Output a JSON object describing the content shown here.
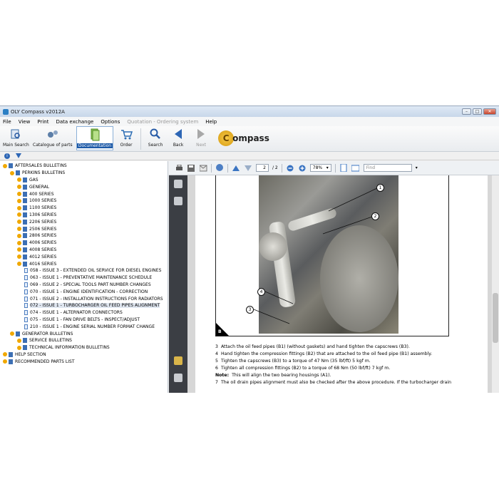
{
  "window": {
    "title": "OLY Compass v2012A"
  },
  "menu": [
    "File",
    "View",
    "Print",
    "Data exchange",
    "Options",
    "Quotation - Ordering system",
    "Help"
  ],
  "menu_disabled": [
    false,
    false,
    false,
    false,
    false,
    true,
    false
  ],
  "toolbar": {
    "main_search": "Main Search",
    "catalogue": "Catalogue of parts",
    "documentation": "Documentation",
    "order": "Order",
    "search": "Search",
    "back": "Back",
    "next": "Next",
    "logo_text": "ompass"
  },
  "tree": [
    {
      "level": 0,
      "type": "book",
      "label": "AFTERSALES BULLETINS"
    },
    {
      "level": 1,
      "type": "book",
      "label": "PERKINS BULLETINS"
    },
    {
      "level": 2,
      "type": "book",
      "label": "GAS"
    },
    {
      "level": 2,
      "type": "book",
      "label": "GENERAL"
    },
    {
      "level": 2,
      "type": "book",
      "label": "400 SERIES"
    },
    {
      "level": 2,
      "type": "book",
      "label": "1000 SERIES"
    },
    {
      "level": 2,
      "type": "book",
      "label": "1100 SERIES"
    },
    {
      "level": 2,
      "type": "book",
      "label": "1306 SERIES"
    },
    {
      "level": 2,
      "type": "book",
      "label": "2206 SERIES"
    },
    {
      "level": 2,
      "type": "book",
      "label": "2506 SERIES"
    },
    {
      "level": 2,
      "type": "book",
      "label": "2806 SERIES"
    },
    {
      "level": 2,
      "type": "book",
      "label": "4006 SERIES"
    },
    {
      "level": 2,
      "type": "book",
      "label": "4008 SERIES"
    },
    {
      "level": 2,
      "type": "book",
      "label": "4012 SERIES"
    },
    {
      "level": 2,
      "type": "book",
      "label": "4016 SERIES"
    },
    {
      "level": 3,
      "type": "doc",
      "label": "058 - ISSUE 3 - EXTENDED OIL SERVICE FOR DIESEL ENGINES"
    },
    {
      "level": 3,
      "type": "doc",
      "label": "063 - ISSUE 1 - PREVENTATIVE MAINTENANCE SCHEDULE"
    },
    {
      "level": 3,
      "type": "doc",
      "label": "069 - ISSUE 2 - SPECIAL TOOLS PART NUMBER CHANGES"
    },
    {
      "level": 3,
      "type": "doc",
      "label": "070 - ISSUE 1 - ENGINE IDENTIFICATION - CORRECTION"
    },
    {
      "level": 3,
      "type": "doc",
      "label": "071 - ISSUE 2 - INSTALLATION INSTRUCTIONS FOR RADIATORS"
    },
    {
      "level": 3,
      "type": "doc",
      "label": "072 - ISSUE 1 - TURBOCHARGER OIL FEED PIPES ALIGNMENT",
      "selected": true
    },
    {
      "level": 3,
      "type": "doc",
      "label": "074 - ISSUE 1 - ALTERNATOR CONNECTORS"
    },
    {
      "level": 3,
      "type": "doc",
      "label": "075 - ISSUE 1 - FAN DRIVE BELTS - INSPECT/ADJUST"
    },
    {
      "level": 3,
      "type": "doc",
      "label": "210 - ISSUE 1 - ENGINE SERIAL NUMBER FORMAT CHANGE"
    },
    {
      "level": 1,
      "type": "book",
      "label": "GENERATOR BULLETINS"
    },
    {
      "level": 2,
      "type": "book",
      "label": "SERVICE BULLETINS"
    },
    {
      "level": 2,
      "type": "book",
      "label": "TECHNICAL INFORMATION BULLETINS"
    },
    {
      "level": 0,
      "type": "book",
      "label": "HELP SECTION"
    },
    {
      "level": 0,
      "type": "book",
      "label": "RECOMMENDED PARTS LIST"
    }
  ],
  "pdf_toolbar": {
    "page_current": "2",
    "page_total": "/ 2",
    "zoom": "78%",
    "find_placeholder": "Find"
  },
  "figure": {
    "letter": "B",
    "callouts": [
      "1",
      "2",
      "4",
      "3"
    ]
  },
  "steps": [
    {
      "num": "3",
      "text": "Attach the oil feed pipes (B1) (without gaskets) and hand tighten the capscrews (B3)."
    },
    {
      "num": "4",
      "text": "Hand tighten the compression fittings (B2) that are attached to the oil feed pipe (B1) assembly."
    },
    {
      "num": "5",
      "text": "Tighten the capscrews (B3) to a torque of 47 Nm (35 lbf/ft) 5 kgf m."
    },
    {
      "num": "6",
      "text": "Tighten all compression fittings (B2) to a torque of 68 Nm (50 lbf/ft) 7 kgf m."
    },
    {
      "num": "Note:",
      "text": "This will align the two bearing housings (A1)."
    },
    {
      "num": "7",
      "text": "The oil drain pipes alignment must also be checked after the above procedure. If the turbocharger drain"
    }
  ]
}
